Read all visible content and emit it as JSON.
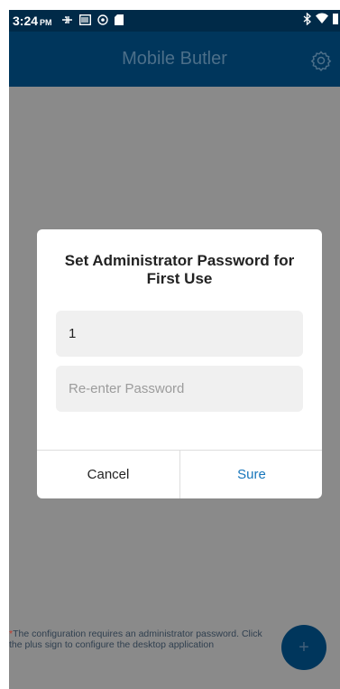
{
  "status_bar": {
    "time": "3:24",
    "ampm": "PM",
    "left_icons": [
      "usb-icon",
      "barcode-icon",
      "sync-icon",
      "sdcard-icon"
    ],
    "right_icons": [
      "bluetooth-icon",
      "wifi-icon",
      "battery-icon"
    ]
  },
  "app_bar": {
    "title": "Mobile Butler",
    "settings_icon": "gear-icon"
  },
  "dialog": {
    "title": "Set Administrator Password for First Use",
    "password_value": "1",
    "reenter_placeholder": "Re-enter Password",
    "cancel_label": "Cancel",
    "sure_label": "Sure"
  },
  "footer": {
    "asterisk": "*",
    "note": "The configuration requires an administrator password. Click the plus sign to configure the desktop application"
  },
  "fab": {
    "label": "+"
  },
  "colors": {
    "app_bar": "#00365c",
    "status_bar": "#002a48",
    "overlay": "#8a8a8a",
    "accent": "#1776bb"
  }
}
